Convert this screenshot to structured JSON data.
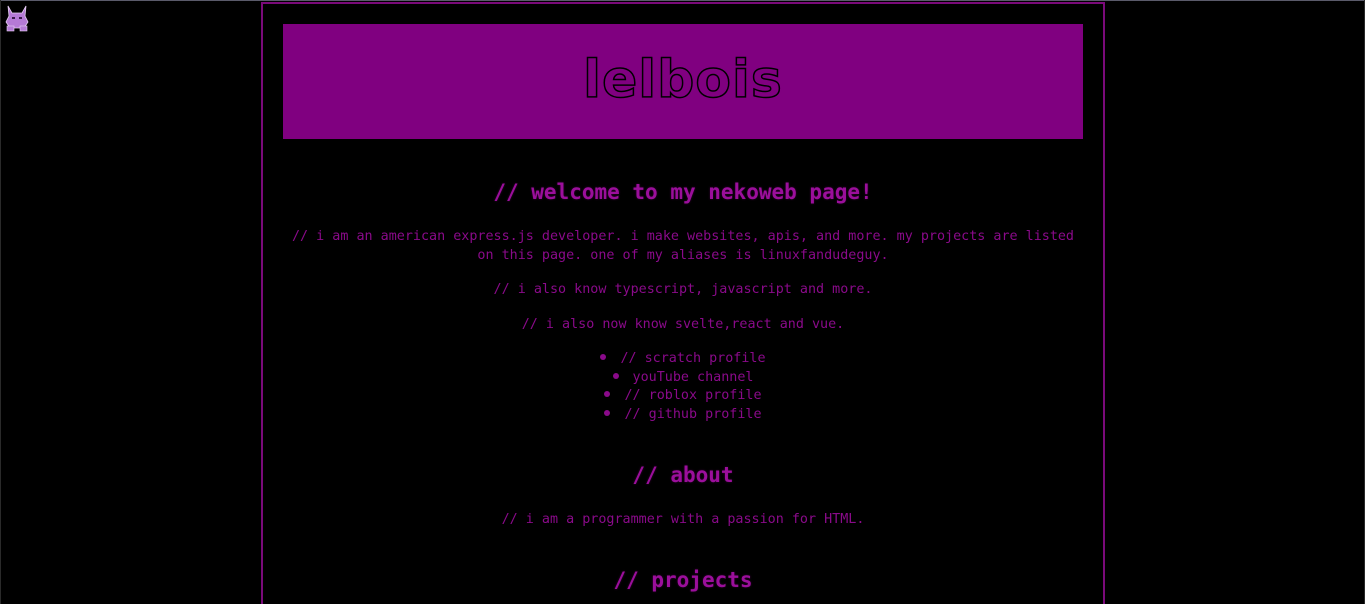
{
  "banner": {
    "title": "lelbois"
  },
  "welcome": {
    "heading": "// welcome to my nekoweb page!",
    "intro": "// i am an american express.js developer. i make websites, apis, and more. my projects are listed on this page. one of my aliases is linuxfandudeguy.",
    "also_know": "// i also know typescript, javascript and more.",
    "also_now": "// i also now know svelte,react and vue."
  },
  "links": [
    {
      "label": "// scratch profile"
    },
    {
      "label": "youTube channel"
    },
    {
      "label": "// roblox profile"
    },
    {
      "label": "// github profile"
    }
  ],
  "about": {
    "heading": "// about",
    "text": "// i am a programmer with a passion for HTML."
  },
  "projects": {
    "heading": "// projects"
  },
  "colors": {
    "background": "#000000",
    "accent": "#800080",
    "text": "#8a0a8a"
  },
  "icons": {
    "corner": "cat-icon"
  }
}
